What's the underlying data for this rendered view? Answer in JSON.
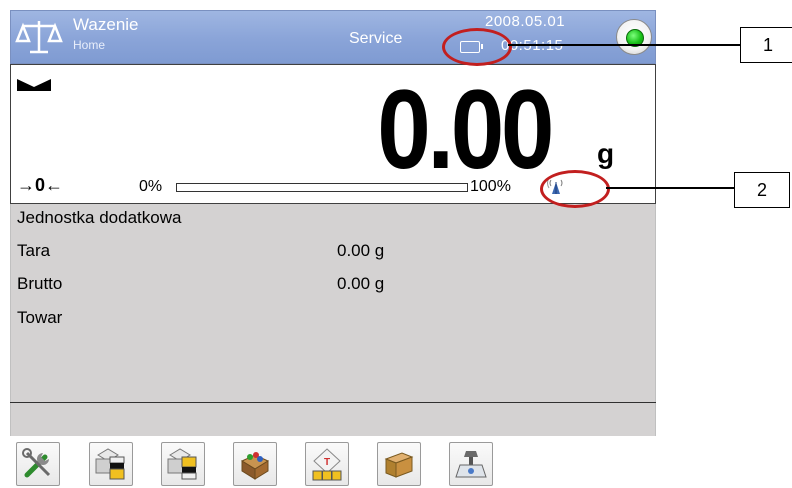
{
  "header": {
    "title": "Wazenie",
    "subtitle": "Home",
    "mode": "Service",
    "date": "2008.05.01",
    "time": "00:51:15"
  },
  "weighing": {
    "value": "0.00",
    "unit": "g",
    "zero_symbol": "→0←",
    "bargraph_min_label": "0%",
    "bargraph_max_label": "100%",
    "bargraph_fill_fraction": 0.0
  },
  "info": {
    "rows": [
      {
        "label": "Jednostka dodatkowa",
        "value": ""
      },
      {
        "label": "Tara",
        "value": "0.00 g"
      },
      {
        "label": "Brutto",
        "value": "0.00 g"
      },
      {
        "label": "Towar",
        "value": ""
      }
    ]
  },
  "toolbar": {
    "buttons": [
      {
        "icon": "tools-icon"
      },
      {
        "icon": "printer-header-icon"
      },
      {
        "icon": "printer-footer-icon"
      },
      {
        "icon": "products-icon"
      },
      {
        "icon": "tare-database-icon"
      },
      {
        "icon": "box-icon"
      },
      {
        "icon": "scale-adjust-icon"
      }
    ]
  },
  "callouts": [
    {
      "label": "1"
    },
    {
      "label": "2"
    }
  ],
  "colors": {
    "header_bg": "#8aa4d8",
    "info_bg": "#d4d2d2",
    "callout_red": "#c21f1f",
    "status_green": "#18c018"
  }
}
